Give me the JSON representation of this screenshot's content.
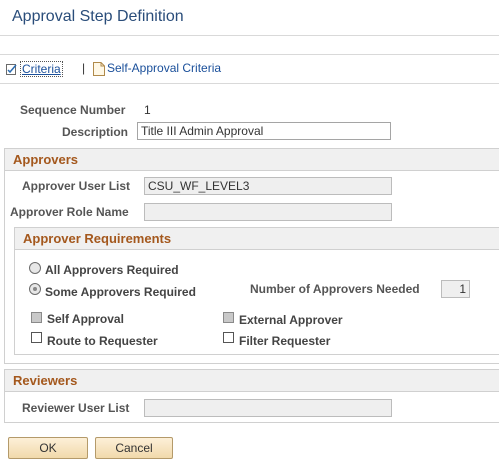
{
  "page": {
    "title": "Approval Step Definition"
  },
  "links": {
    "criteria": "Criteria",
    "separator": "|",
    "self_approval_criteria": "Self-Approval Criteria"
  },
  "sequence": {
    "label": "Sequence Number",
    "value": "1"
  },
  "description": {
    "label": "Description",
    "value": "Title III Admin Approval"
  },
  "approvers": {
    "header": "Approvers",
    "user_list_label": "Approver User List",
    "user_list_value": "CSU_WF_LEVEL3",
    "role_name_label": "Approver Role Name",
    "role_name_value": ""
  },
  "requirements": {
    "header": "Approver Requirements",
    "all_required": "All Approvers Required",
    "some_required": "Some Approvers Required",
    "selected": "some_required",
    "needed_label": "Number of Approvers Needed",
    "needed_value": "1",
    "self_approval": "Self Approval",
    "external_approver": "External Approver",
    "route_to_requester": "Route to Requester",
    "filter_requester": "Filter Requester"
  },
  "reviewers": {
    "header": "Reviewers",
    "user_list_label": "Reviewer User List",
    "user_list_value": ""
  },
  "buttons": {
    "ok": "OK",
    "cancel": "Cancel"
  },
  "colors": {
    "section_header_text": "#a4581d",
    "link": "#1a4f9a",
    "title": "#2a4d7a",
    "button_bg": "#f1d9ab"
  }
}
